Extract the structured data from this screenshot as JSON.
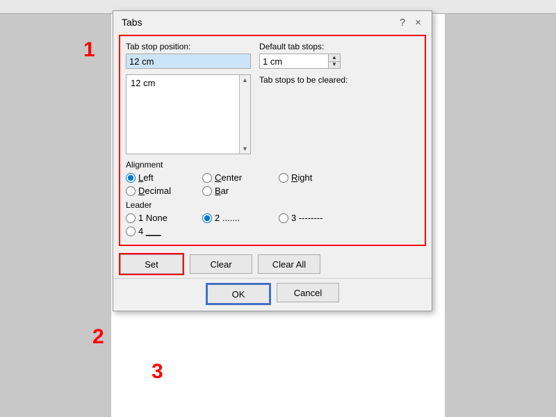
{
  "dialog": {
    "title": "Tabs",
    "help_btn": "?",
    "close_btn": "×"
  },
  "tab_stop_position": {
    "label": "Tab stop position:",
    "value": "12 cm",
    "list_items": [
      "12 cm"
    ]
  },
  "default_tab_stops": {
    "label": "Default tab stops:",
    "value": "1 cm"
  },
  "tab_stops_to_clear": {
    "label": "Tab stops to be cleared:"
  },
  "alignment": {
    "label": "Alignment",
    "options": [
      {
        "id": "left",
        "label": "Left",
        "checked": true
      },
      {
        "id": "center",
        "label": "Center",
        "checked": false
      },
      {
        "id": "right",
        "label": "Right",
        "checked": false
      },
      {
        "id": "decimal",
        "label": "Decimal",
        "checked": false
      },
      {
        "id": "bar",
        "label": "Bar",
        "checked": false
      }
    ]
  },
  "leader": {
    "label": "Leader",
    "options": [
      {
        "id": "l1",
        "label": "1 None",
        "checked": false
      },
      {
        "id": "l2",
        "label": "2 .......",
        "checked": true
      },
      {
        "id": "l3",
        "label": "3 --------",
        "checked": false
      },
      {
        "id": "l4",
        "label": "4 ___",
        "checked": false
      }
    ]
  },
  "buttons": {
    "set": "Set",
    "clear": "Clear",
    "clear_all": "Clear All",
    "ok": "OK",
    "cancel": "Cancel"
  },
  "annotations": {
    "a1": "1",
    "a2": "2",
    "a3": "3"
  }
}
